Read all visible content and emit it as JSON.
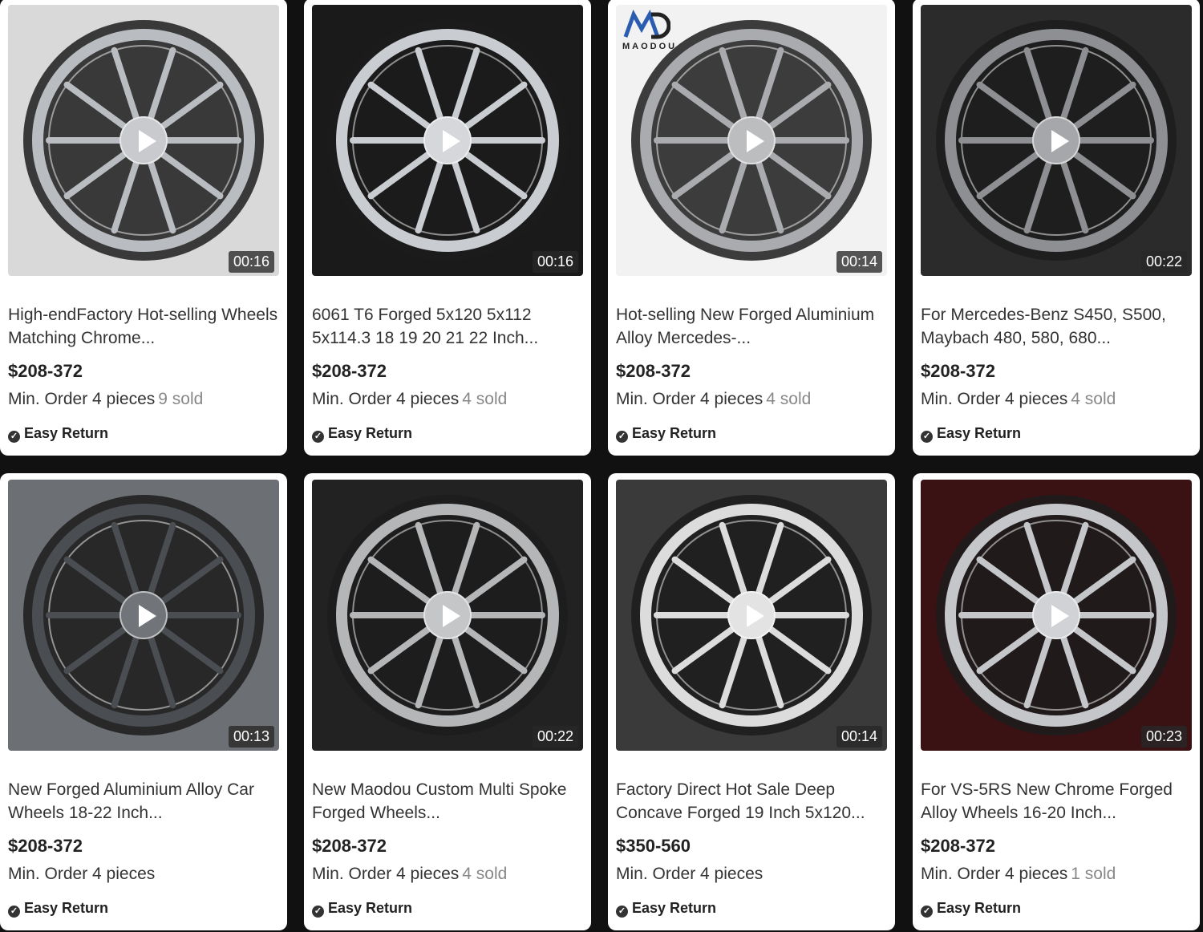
{
  "products": [
    {
      "title": "High-endFactory Hot-selling Wheels Matching Chrome...",
      "price": "$208-372",
      "min_order": "Min. Order",
      "qty": "4 pieces",
      "sold": "9 sold",
      "badge": "Easy Return",
      "duration": "00:16",
      "bg": "#d9d9d9",
      "rim": "#b9bcc0",
      "scene": "chrome-cross-wheel"
    },
    {
      "title": "6061 T6 Forged 5x120 5x112 5x114.3 18 19 20 21 22 Inch...",
      "price": "$208-372",
      "min_order": "Min. Order",
      "qty": "4 pieces",
      "sold": "4 sold",
      "badge": "Easy Return",
      "duration": "00:16",
      "bg": "#1a1a1a",
      "rim": "#c9ccd1",
      "scene": "chrome-wheel-red-caliper"
    },
    {
      "title": "Hot-selling New Forged Aluminium Alloy Mercedes-...",
      "price": "$208-372",
      "min_order": "Min. Order",
      "qty": "4 pieces",
      "sold": "4 sold",
      "badge": "Easy Return",
      "duration": "00:14",
      "bg": "#f2f2f2",
      "rim": "#a9abae",
      "scene": "silver-five-spoke-wheel",
      "logo": "MAODOU"
    },
    {
      "title": "For Mercedes-Benz S450, S500, Maybach 480, 580, 680...",
      "price": "$208-372",
      "min_order": "Min. Order",
      "qty": "4 pieces",
      "sold": "4 sold",
      "badge": "Easy Return",
      "duration": "00:22",
      "bg": "#2b2b2b",
      "rim": "#8d8f92",
      "scene": "black-mercedes-wheel"
    },
    {
      "title": "New Forged Aluminium Alloy Car Wheels 18-22 Inch...",
      "price": "$208-372",
      "min_order": "Min. Order",
      "qty": "4 pieces",
      "sold": "",
      "badge": "Easy Return",
      "duration": "00:13",
      "bg": "#6c6f73",
      "rim": "#4a4d52",
      "scene": "gunmetal-wheel"
    },
    {
      "title": "New Maodou Custom Multi Spoke Forged Wheels...",
      "price": "$208-372",
      "min_order": "Min. Order",
      "qty": "4 pieces",
      "sold": "4 sold",
      "badge": "Easy Return",
      "duration": "00:22",
      "bg": "#222222",
      "rim": "#b4b6b8",
      "scene": "multi-spoke-wheel"
    },
    {
      "title": "Factory Direct Hot Sale Deep Concave Forged 19 Inch 5x120...",
      "price": "$350-560",
      "min_order": "Min. Order",
      "qty": "4 pieces",
      "sold": "",
      "badge": "Easy Return",
      "duration": "00:14",
      "bg": "#3a3a3a",
      "rim": "#dcdcdc",
      "scene": "mesh-silver-wheel"
    },
    {
      "title": "For VS-5RS New Chrome Forged Alloy Wheels 16-20 Inch...",
      "price": "$208-372",
      "min_order": "Min. Order",
      "qty": "4 pieces",
      "sold": "1 sold",
      "badge": "Easy Return",
      "duration": "00:23",
      "bg": "#3a1214",
      "rim": "#c4c6ca",
      "scene": "chrome-red-display-wheel"
    }
  ]
}
